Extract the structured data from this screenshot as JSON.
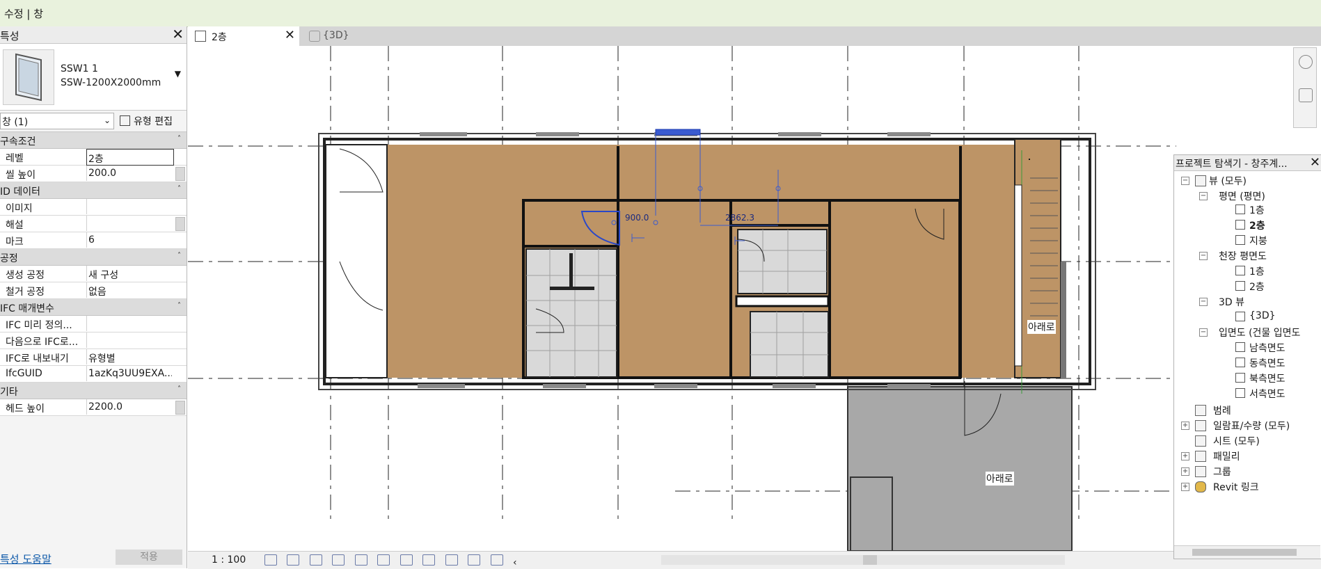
{
  "ribbon": {
    "context": "수정 | 창"
  },
  "properties": {
    "title": "특성",
    "type": {
      "family": "SSW1 1",
      "name": "SSW-1200X2000mm"
    },
    "filter": "창 (1)",
    "edit_type": "유형 편집",
    "sections": [
      {
        "label": "구속조건",
        "rows": [
          {
            "key": "레벨",
            "value": "2층"
          },
          {
            "key": "씰 높이",
            "value": "200.0"
          }
        ]
      },
      {
        "label": "ID 데이터",
        "rows": [
          {
            "key": "이미지",
            "value": ""
          },
          {
            "key": "해설",
            "value": ""
          },
          {
            "key": "마크",
            "value": "6"
          }
        ]
      },
      {
        "label": "공정",
        "rows": [
          {
            "key": "생성 공정",
            "value": "새 구성"
          },
          {
            "key": "철거 공정",
            "value": "없음"
          }
        ]
      },
      {
        "label": "IFC 매개변수",
        "rows": [
          {
            "key": "IFC 미리 정의...",
            "value": ""
          },
          {
            "key": "다음으로 IFC로...",
            "value": ""
          },
          {
            "key": "IFC로 내보내기",
            "value": "유형별"
          },
          {
            "key": "IfcGUID",
            "value": "1azKq3UU9EXA..."
          }
        ]
      },
      {
        "label": "기타",
        "rows": [
          {
            "key": "헤드 높이",
            "value": "2200.0"
          }
        ]
      }
    ],
    "help": "특성 도움말",
    "apply": "적용"
  },
  "tabs": [
    {
      "label": "2층"
    },
    {
      "label": "{3D}"
    }
  ],
  "canvas": {
    "dim_a": "900.0",
    "dim_b": "2862.3",
    "stair_label_1": "아래로",
    "stair_label_2": "아래로"
  },
  "status": {
    "scale": "1 : 100"
  },
  "browser": {
    "title": "프로젝트 탐색기 - 창주계...",
    "nodes": {
      "views_all": "뷰 (모두)",
      "floor_plans": "평면 (평면)",
      "fp_1": "1층",
      "fp_2": "2층",
      "fp_roof": "지붕",
      "ceiling_plans": "천장 평면도",
      "cp_1": "1층",
      "cp_2": "2층",
      "views_3d": "3D 뷰",
      "v3d": "{3D}",
      "elevations": "입면도 (건물 입면도",
      "el_s": "남측면도",
      "el_e": "동측면도",
      "el_n": "북측면도",
      "el_w": "서측면도",
      "legends": "범례",
      "schedules": "일람표/수량 (모두)",
      "sheets": "시트 (모두)",
      "families": "패밀리",
      "groups": "그룹",
      "revit_links": "Revit 링크"
    }
  },
  "colors": {
    "floor": "#bd9466",
    "tile": "#d9d9d9",
    "slab": "#a8a8a8",
    "ribbon": "#e9f2dd"
  }
}
